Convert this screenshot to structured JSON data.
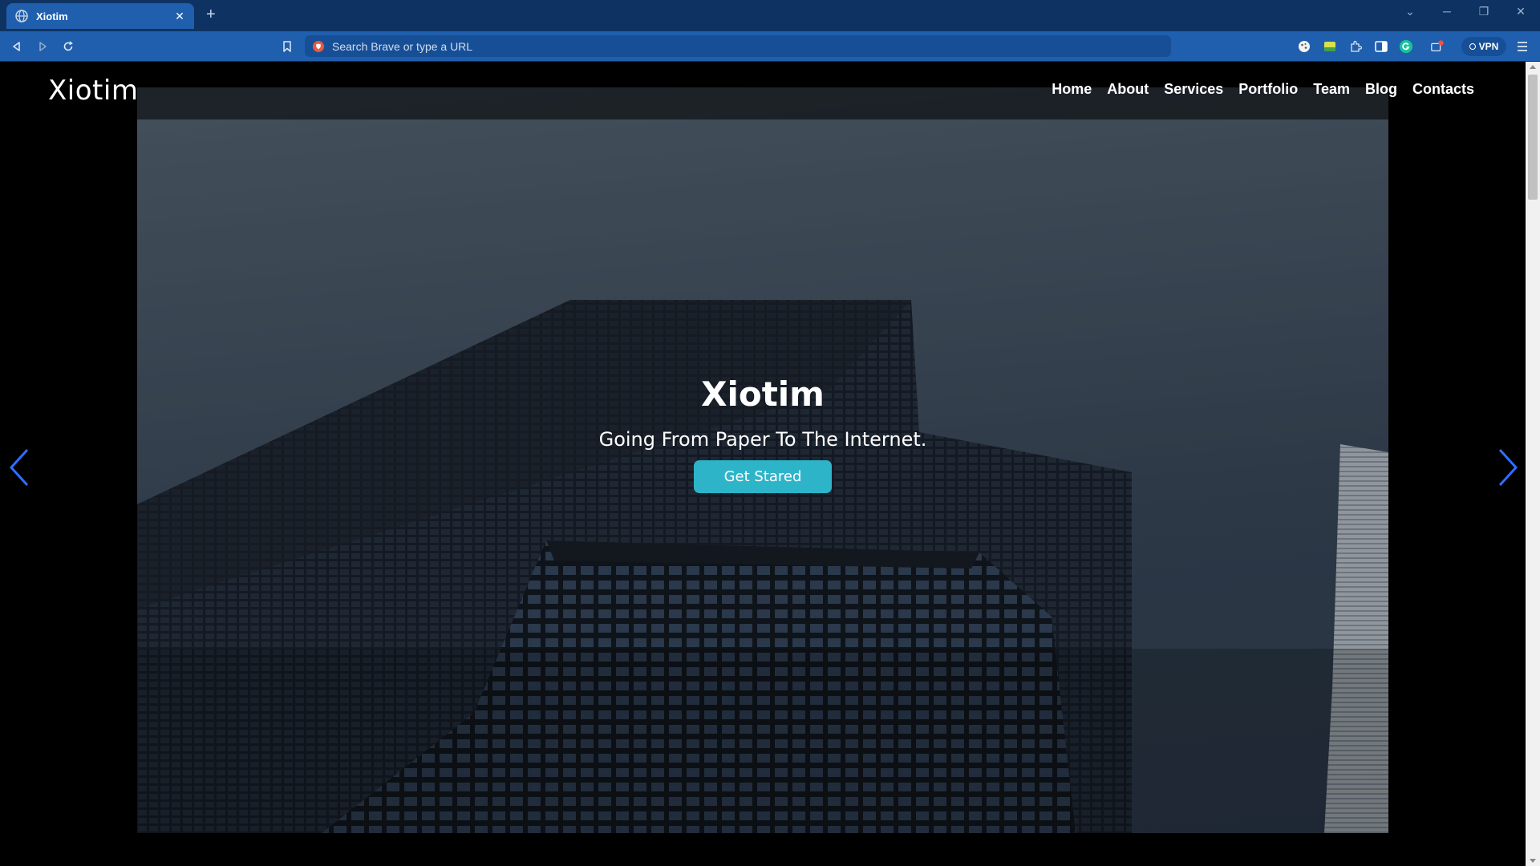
{
  "browser": {
    "tab": {
      "title": "Xiotim",
      "close": "✕"
    },
    "new_tab": "+",
    "url_placeholder": "Search Brave or type a URL",
    "vpn_label": "VPN",
    "window": {
      "minimize": "─",
      "restore": "❐",
      "close": "✕",
      "tabs_menu": "⌄"
    }
  },
  "site": {
    "logo": "Xiotim",
    "nav": [
      "Home",
      "About",
      "Services",
      "Portfolio",
      "Team",
      "Blog",
      "Contacts"
    ],
    "hero": {
      "title": "Xiotim",
      "subtitle": "Going From Paper To The Internet.",
      "button": "Get Stared"
    }
  },
  "colors": {
    "chrome_dark": "#0e3363",
    "chrome": "#1f5fae",
    "accent_button": "#2eb4c9",
    "carousel_arrow": "#2f6fff"
  },
  "icons": [
    "globe-icon",
    "back-icon",
    "forward-icon",
    "reload-icon",
    "bookmark-icon",
    "brave-shield-icon",
    "extensions-icon",
    "sidebar-icon",
    "menu-icon",
    "chevron-left-icon",
    "chevron-right-icon"
  ]
}
